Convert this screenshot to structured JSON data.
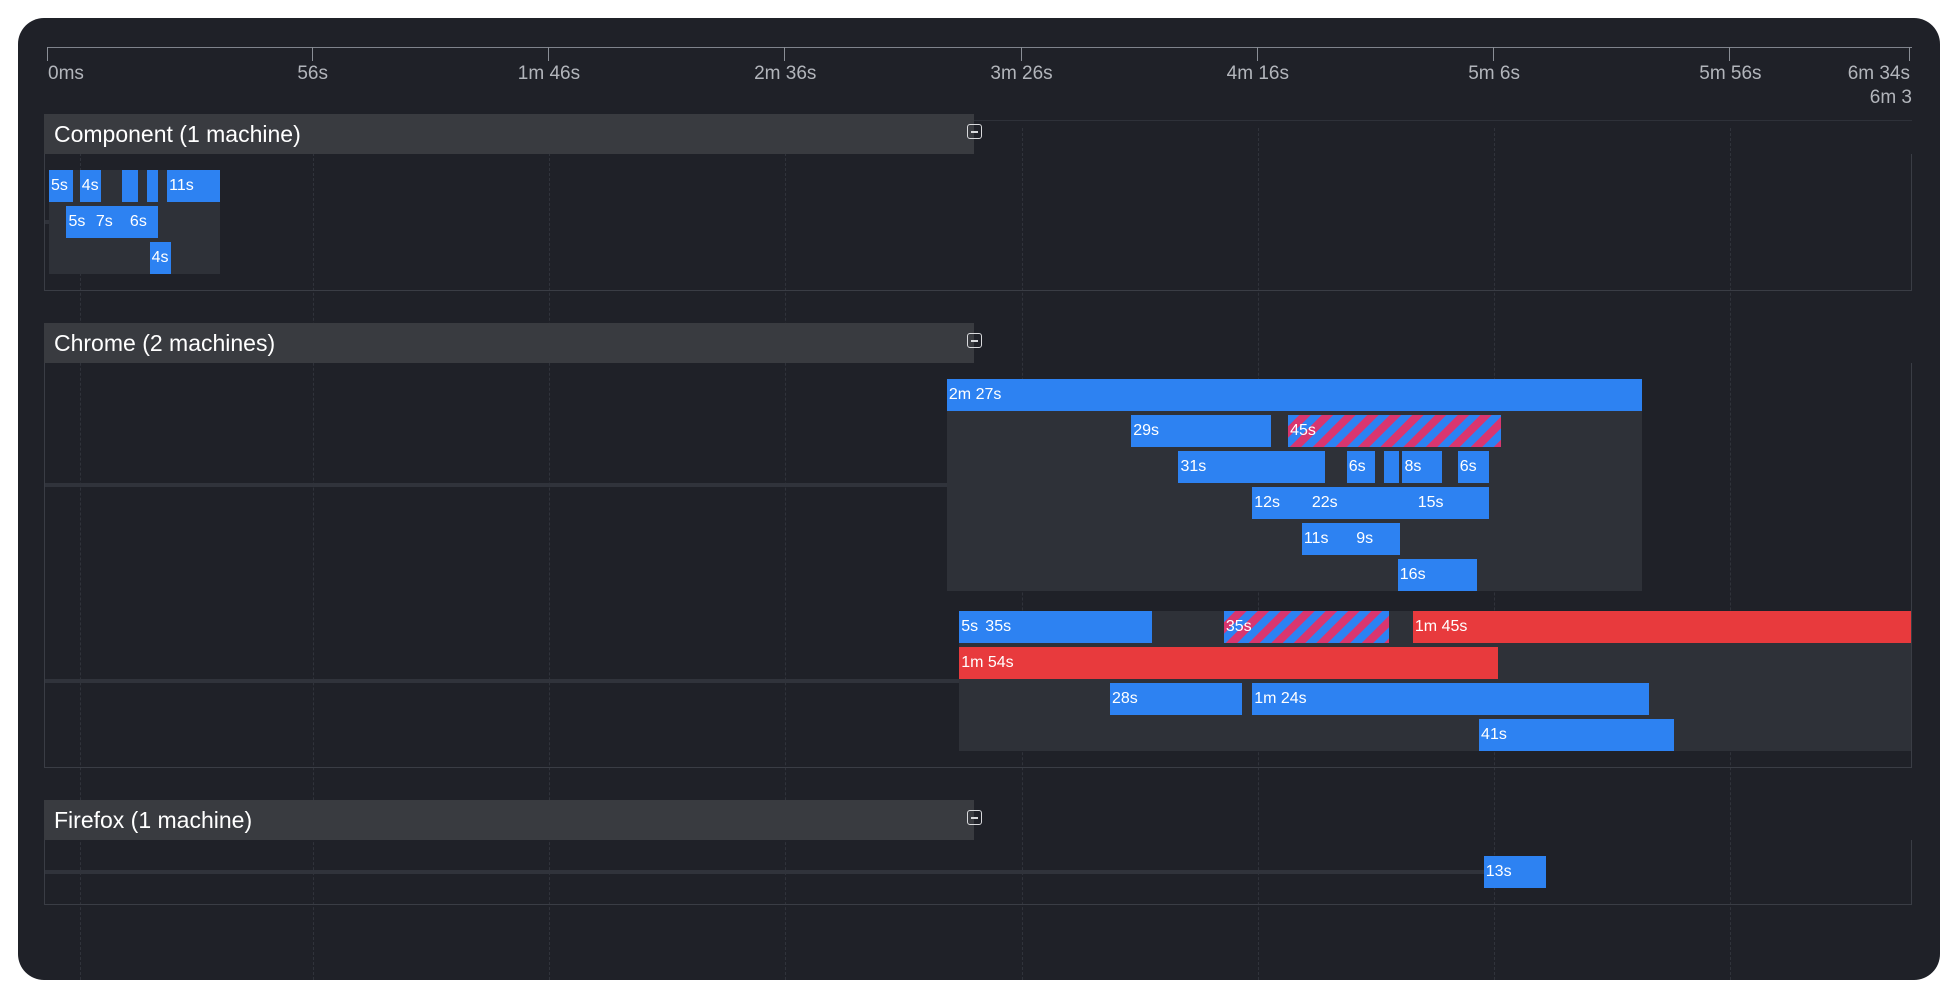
{
  "timeline": {
    "duration_seconds": 394,
    "ticks": [
      {
        "label": "0ms",
        "seconds": 0
      },
      {
        "label": "56s",
        "seconds": 56
      },
      {
        "label": "1m 46s",
        "seconds": 106
      },
      {
        "label": "2m 36s",
        "seconds": 156
      },
      {
        "label": "3m 26s",
        "seconds": 206
      },
      {
        "label": "4m 16s",
        "seconds": 256
      },
      {
        "label": "5m 6s",
        "seconds": 306
      },
      {
        "label": "5m 56s",
        "seconds": 356
      },
      {
        "label": "6m 34s",
        "seconds": 394
      }
    ],
    "overflow_label": "6m 3"
  },
  "status_colors": {
    "passed": "#2d82f2",
    "failed": "#e83a3d",
    "flaky_stripe": "#d9366f"
  },
  "groups": [
    {
      "title": "Component (1 machine)",
      "collapse_icon": "minus-square-icon",
      "machines": [
        {
          "rows": [
            [
              {
                "label": "5s",
                "start": 0,
                "duration": 5,
                "status": "passed"
              },
              {
                "label": "4s",
                "start": 6.5,
                "duration": 4.6,
                "status": "passed"
              },
              {
                "label": "",
                "start": 15.4,
                "duration": 3.4,
                "status": "passed"
              },
              {
                "label": "",
                "start": 20.8,
                "duration": 2.2,
                "status": "passed"
              },
              {
                "label": "11s",
                "start": 25,
                "duration": 11.1,
                "status": "passed"
              }
            ],
            [
              {
                "label": "5s",
                "start": 3.7,
                "duration": 5.8,
                "status": "passed"
              },
              {
                "label": "7s",
                "start": 9.5,
                "duration": 7.2,
                "status": "passed"
              },
              {
                "label": "6s",
                "start": 16.7,
                "duration": 6.3,
                "status": "passed"
              }
            ],
            [
              {
                "label": "4s",
                "start": 21.3,
                "duration": 4.6,
                "status": "passed"
              }
            ]
          ]
        }
      ]
    },
    {
      "title": "Chrome (2 machines)",
      "collapse_icon": "minus-square-icon",
      "machines": [
        {
          "rows": [
            [
              {
                "label": "2m 27s",
                "start": 190,
                "duration": 147,
                "status": "passed"
              }
            ],
            [
              {
                "label": "29s",
                "start": 229,
                "duration": 29.5,
                "status": "passed"
              },
              {
                "label": "45s",
                "start": 262.2,
                "duration": 45,
                "status": "flaky"
              }
            ],
            [
              {
                "label": "31s",
                "start": 239,
                "duration": 31,
                "status": "passed"
              },
              {
                "label": "6s",
                "start": 274.6,
                "duration": 6,
                "status": "passed"
              },
              {
                "label": "",
                "start": 282.5,
                "duration": 3.2,
                "status": "passed"
              },
              {
                "label": "8s",
                "start": 286.4,
                "duration": 8.3,
                "status": "passed"
              },
              {
                "label": "6s",
                "start": 298.1,
                "duration": 6.7,
                "status": "passed"
              }
            ],
            [
              {
                "label": "12s",
                "start": 254.6,
                "duration": 12.2,
                "status": "passed"
              },
              {
                "label": "22s",
                "start": 266.8,
                "duration": 22.4,
                "status": "passed"
              },
              {
                "label": "15s",
                "start": 289.2,
                "duration": 15.5,
                "status": "passed"
              }
            ],
            [
              {
                "label": "11s",
                "start": 265.1,
                "duration": 11.1,
                "status": "passed"
              },
              {
                "label": "9s",
                "start": 276.2,
                "duration": 9.7,
                "status": "passed"
              }
            ],
            [
              {
                "label": "16s",
                "start": 285.4,
                "duration": 16.7,
                "status": "passed"
              }
            ]
          ]
        },
        {
          "rows": [
            [
              {
                "label": "5s",
                "start": 192.6,
                "duration": 5.1,
                "status": "passed"
              },
              {
                "label": "35s",
                "start": 197.7,
                "duration": 35.6,
                "status": "passed"
              },
              {
                "label": "35s",
                "start": 248.6,
                "duration": 35,
                "status": "flaky"
              },
              {
                "label": "1m 45s",
                "start": 288.6,
                "duration": 105.4,
                "status": "failed"
              }
            ],
            [
              {
                "label": "1m 54s",
                "start": 192.6,
                "duration": 114,
                "status": "failed"
              }
            ],
            [
              {
                "label": "28s",
                "start": 224.5,
                "duration": 28,
                "status": "passed"
              },
              {
                "label": "1m 24s",
                "start": 254.6,
                "duration": 84,
                "status": "passed"
              }
            ],
            [
              {
                "label": "41s",
                "start": 302.6,
                "duration": 41.2,
                "status": "passed"
              }
            ]
          ]
        }
      ]
    },
    {
      "title": "Firefox (1 machine)",
      "collapse_icon": "minus-square-icon",
      "machines": [
        {
          "rows": [
            [
              {
                "label": "13s",
                "start": 303.6,
                "duration": 13.1,
                "status": "passed"
              }
            ]
          ]
        }
      ]
    }
  ]
}
